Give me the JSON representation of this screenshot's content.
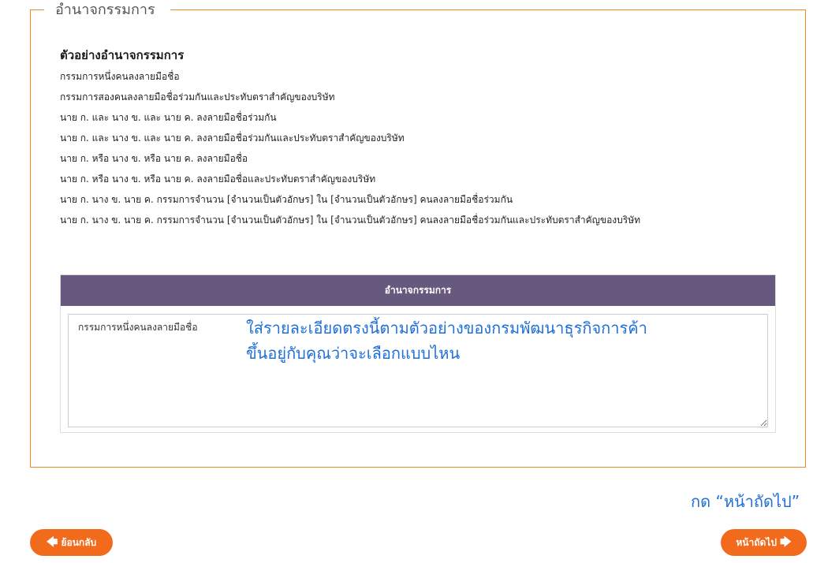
{
  "section": {
    "legend": "อำนาจกรรมการ"
  },
  "examples": {
    "heading": "ตัวอย่างอำนาจกรรมการ",
    "items": [
      "กรรมการหนึ่งคนลงลายมือชื่อ",
      "กรรมการสองคนลงลายมือชื่อร่วมกันและประทับตราสำคัญของบริษัท",
      "นาย ก. และ นาง ข. และ นาย ค. ลงลายมือชื่อร่วมกัน",
      "นาย ก. และ นาง ข. และ นาย ค. ลงลายมือชื่อร่วมกันและประทับตราสำคัญของบริษัท",
      "นาย ก. หรือ นาง ข. หรือ นาย ค. ลงลายมือชื่อ",
      "นาย ก. หรือ นาง ข. หรือ นาย ค. ลงลายมือชื่อและประทับตราสำคัญของบริษัท",
      "นาย ก. นาง ข. นาย ค. กรรมการจำนวน [จำนวนเป็นตัวอักษร] ใน [จำนวนเป็นตัวอักษร] คนลงลายมือชื่อร่วมกัน",
      "นาย ก. นาง ข. นาย ค. กรรมการจำนวน [จำนวนเป็นตัวอักษร] ใน [จำนวนเป็นตัวอักษร] คนลงลายมือชื่อร่วมกันและประทับตราสำคัญของบริษัท"
    ]
  },
  "panel": {
    "header": "อำนาจกรรมการ",
    "textarea_value": "กรรมการหนึ่งคนลงลายมือชื่อ"
  },
  "annotation": {
    "line1": "ใส่รายละเอียดตรงนี้ตามตัวอย่างของกรมพัฒนาธุรกิจการค้า",
    "line2": "ขึ้นอยู่กับคุณว่าจะเลือกแบบไหน",
    "next_hint": "กด “หน้าถัดไป”"
  },
  "nav": {
    "back_label": "ย้อนกลับ",
    "next_label": "หน้าถัดไป",
    "back_icon": "arrow-left-icon",
    "next_icon": "arrow-right-icon"
  },
  "colors": {
    "accent": "#f26a1b",
    "border": "#f08a24",
    "panel_header": "#67597d",
    "annotation": "#1f6fd6"
  }
}
